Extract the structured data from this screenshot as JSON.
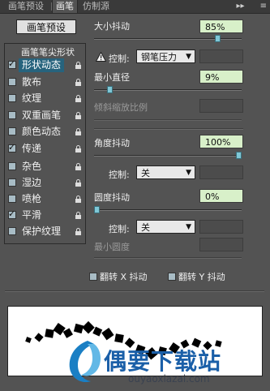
{
  "tabs": [
    {
      "label": "画笔预设",
      "active": false
    },
    {
      "label": "画笔",
      "active": true
    },
    {
      "label": "仿制源",
      "active": false
    }
  ],
  "tabbar_icons": {
    "collapse": "▸▸",
    "menu": "≡"
  },
  "preset_button": "画笔预设",
  "tip_shape_label": "画笔笔尖形状",
  "brush_options": [
    {
      "label": "形状动态",
      "checked": true,
      "selected": true
    },
    {
      "label": "散布",
      "checked": false,
      "selected": false
    },
    {
      "label": "纹理",
      "checked": false,
      "selected": false
    },
    {
      "label": "双重画笔",
      "checked": false,
      "selected": false
    },
    {
      "label": "颜色动态",
      "checked": false,
      "selected": false
    },
    {
      "label": "传递",
      "checked": true,
      "selected": false
    },
    {
      "label": "杂色",
      "checked": false,
      "selected": false
    },
    {
      "label": "湿边",
      "checked": false,
      "selected": false
    },
    {
      "label": "喷枪",
      "checked": false,
      "selected": false
    },
    {
      "label": "平滑",
      "checked": true,
      "selected": false
    },
    {
      "label": "保护纹理",
      "checked": false,
      "selected": false
    }
  ],
  "size_jitter": {
    "label": "大小抖动",
    "value": "85%",
    "level": 0.85
  },
  "size_control": {
    "warning_icon": "warning-icon",
    "label": "控制:",
    "selected": "钢笔压力"
  },
  "min_diameter": {
    "label": "最小直径",
    "value": "9%",
    "level": 0.09
  },
  "tilt_scale": {
    "label": "倾斜缩放比例"
  },
  "angle_jitter": {
    "label": "角度抖动",
    "value": "100%",
    "level": 1.0
  },
  "angle_control": {
    "label": "控制:",
    "selected": "关"
  },
  "roundness_jitter": {
    "label": "圆度抖动",
    "value": "0%",
    "level": 0.0
  },
  "roundness_control": {
    "label": "控制:",
    "selected": "关"
  },
  "min_roundness": {
    "label": "最小圆度"
  },
  "flip_x": {
    "label": "翻转 X 抖动"
  },
  "flip_y": {
    "label": "翻转 Y 抖动"
  },
  "watermark": {
    "title": "偶要下载站",
    "url": "ouyaoxiazai.com"
  },
  "colors": {
    "accent": "#7fc7d6",
    "value_bg": "#d8f0c9",
    "selected_bg": "#27637d",
    "panel": "#535353"
  }
}
